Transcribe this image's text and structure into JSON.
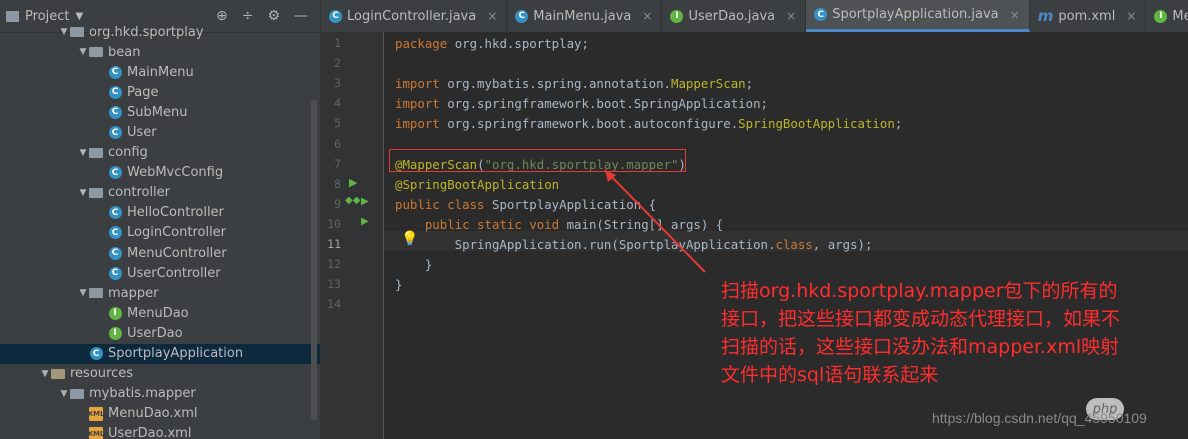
{
  "sidebar": {
    "title": "Project",
    "tree": [
      {
        "label": "org.hkd.sportplay",
        "kind": "folder",
        "depth": 1,
        "expanded": true
      },
      {
        "label": "bean",
        "kind": "folder",
        "depth": 2,
        "expanded": true
      },
      {
        "label": "MainMenu",
        "kind": "class",
        "depth": 3
      },
      {
        "label": "Page",
        "kind": "class",
        "depth": 3
      },
      {
        "label": "SubMenu",
        "kind": "class",
        "depth": 3
      },
      {
        "label": "User",
        "kind": "class",
        "depth": 3
      },
      {
        "label": "config",
        "kind": "folder",
        "depth": 2,
        "expanded": true
      },
      {
        "label": "WebMvcConfig",
        "kind": "class",
        "depth": 3
      },
      {
        "label": "controller",
        "kind": "folder",
        "depth": 2,
        "expanded": true
      },
      {
        "label": "HelloController",
        "kind": "class",
        "depth": 3
      },
      {
        "label": "LoginController",
        "kind": "class",
        "depth": 3
      },
      {
        "label": "MenuController",
        "kind": "class",
        "depth": 3
      },
      {
        "label": "UserController",
        "kind": "class",
        "depth": 3
      },
      {
        "label": "mapper",
        "kind": "folder",
        "depth": 2,
        "expanded": true
      },
      {
        "label": "MenuDao",
        "kind": "interface",
        "depth": 3
      },
      {
        "label": "UserDao",
        "kind": "interface",
        "depth": 3
      },
      {
        "label": "SportplayApplication",
        "kind": "boot",
        "depth": 2,
        "selected": true
      },
      {
        "label": "resources",
        "kind": "resfolder",
        "depth": 0,
        "expanded": true
      },
      {
        "label": "mybatis.mapper",
        "kind": "folder",
        "depth": 1,
        "expanded": true
      },
      {
        "label": "MenuDao.xml",
        "kind": "xml",
        "depth": 2
      },
      {
        "label": "UserDao.xml",
        "kind": "xml",
        "depth": 2
      }
    ]
  },
  "tabs": [
    {
      "label": "LoginController.java",
      "icon": "class",
      "active": false
    },
    {
      "label": "MainMenu.java",
      "icon": "class",
      "active": false
    },
    {
      "label": "UserDao.java",
      "icon": "interface",
      "active": false
    },
    {
      "label": "SportplayApplication.java",
      "icon": "boot",
      "active": true
    },
    {
      "label": "pom.xml",
      "icon": "maven",
      "active": false
    },
    {
      "label": "MenuDao.java",
      "icon": "interface",
      "active": false
    }
  ],
  "editor": {
    "current_line": 11,
    "lines": [
      {
        "n": "1",
        "parts": [
          [
            "kw",
            "package "
          ],
          [
            "t",
            "org.hkd.sportplay;"
          ]
        ]
      },
      {
        "n": "2",
        "parts": []
      },
      {
        "n": "3",
        "parts": [
          [
            "kw",
            "import "
          ],
          [
            "t",
            "org.mybatis.spring.annotation."
          ],
          [
            "ann",
            "MapperScan"
          ],
          [
            "t",
            ";"
          ]
        ]
      },
      {
        "n": "4",
        "parts": [
          [
            "kw",
            "import "
          ],
          [
            "t",
            "org.springframework.boot.SpringApplication;"
          ]
        ]
      },
      {
        "n": "5",
        "parts": [
          [
            "kw",
            "import "
          ],
          [
            "t",
            "org.springframework.boot.autoconfigure."
          ],
          [
            "ann",
            "SpringBootApplication"
          ],
          [
            "t",
            ";"
          ]
        ]
      },
      {
        "n": "6",
        "parts": []
      },
      {
        "n": "7",
        "parts": [
          [
            "ann",
            "@MapperScan"
          ],
          [
            "t",
            "("
          ],
          [
            "str",
            "\"org.hkd.sportplay.mapper\""
          ],
          [
            "t",
            ")"
          ]
        ]
      },
      {
        "n": "8",
        "parts": [
          [
            "ann",
            "@SpringBootApplication"
          ]
        ]
      },
      {
        "n": "9",
        "parts": [
          [
            "kw",
            "public class "
          ],
          [
            "t",
            "SportplayApplication {"
          ]
        ]
      },
      {
        "n": "10",
        "parts": [
          [
            "t",
            "    "
          ],
          [
            "kw",
            "public static void "
          ],
          [
            "t",
            "main(String[] args) {"
          ]
        ]
      },
      {
        "n": "11",
        "parts": [
          [
            "t",
            "        SpringApplication."
          ],
          [
            "t",
            "run"
          ],
          [
            "t",
            "(SportplayApplication."
          ],
          [
            "kw",
            "class"
          ],
          [
            "t",
            ", args);"
          ]
        ]
      },
      {
        "n": "12",
        "parts": [
          [
            "t",
            "    }"
          ]
        ]
      },
      {
        "n": "13",
        "parts": [
          [
            "t",
            "}"
          ]
        ]
      },
      {
        "n": "14",
        "parts": []
      }
    ]
  },
  "annotation_note": "扫描org.hkd.sportplay.mapper包下的所有的接口，把这些接口都变成动态代理接口，如果不扫描的话，这些接口没办法和mapper.xml映射文件中的sql语句联系起来",
  "annotation_lines": [
    "扫描org.hkd.sportplay.mapper包下的所有的",
    "接口，把这些接口都变成动态代理接口，如果不",
    "扫描的话，这些接口没办法和mapper.xml映射",
    "文件中的sql语句联系起来"
  ],
  "watermark": "https://blog.csdn.net/qq_45950109",
  "watermark_badge": "php",
  "colors": {
    "keyword": "#cc7832",
    "annotation": "#bbb529",
    "string": "#6a8759",
    "text": "#a9b7c6",
    "highlight": "#e53935"
  }
}
